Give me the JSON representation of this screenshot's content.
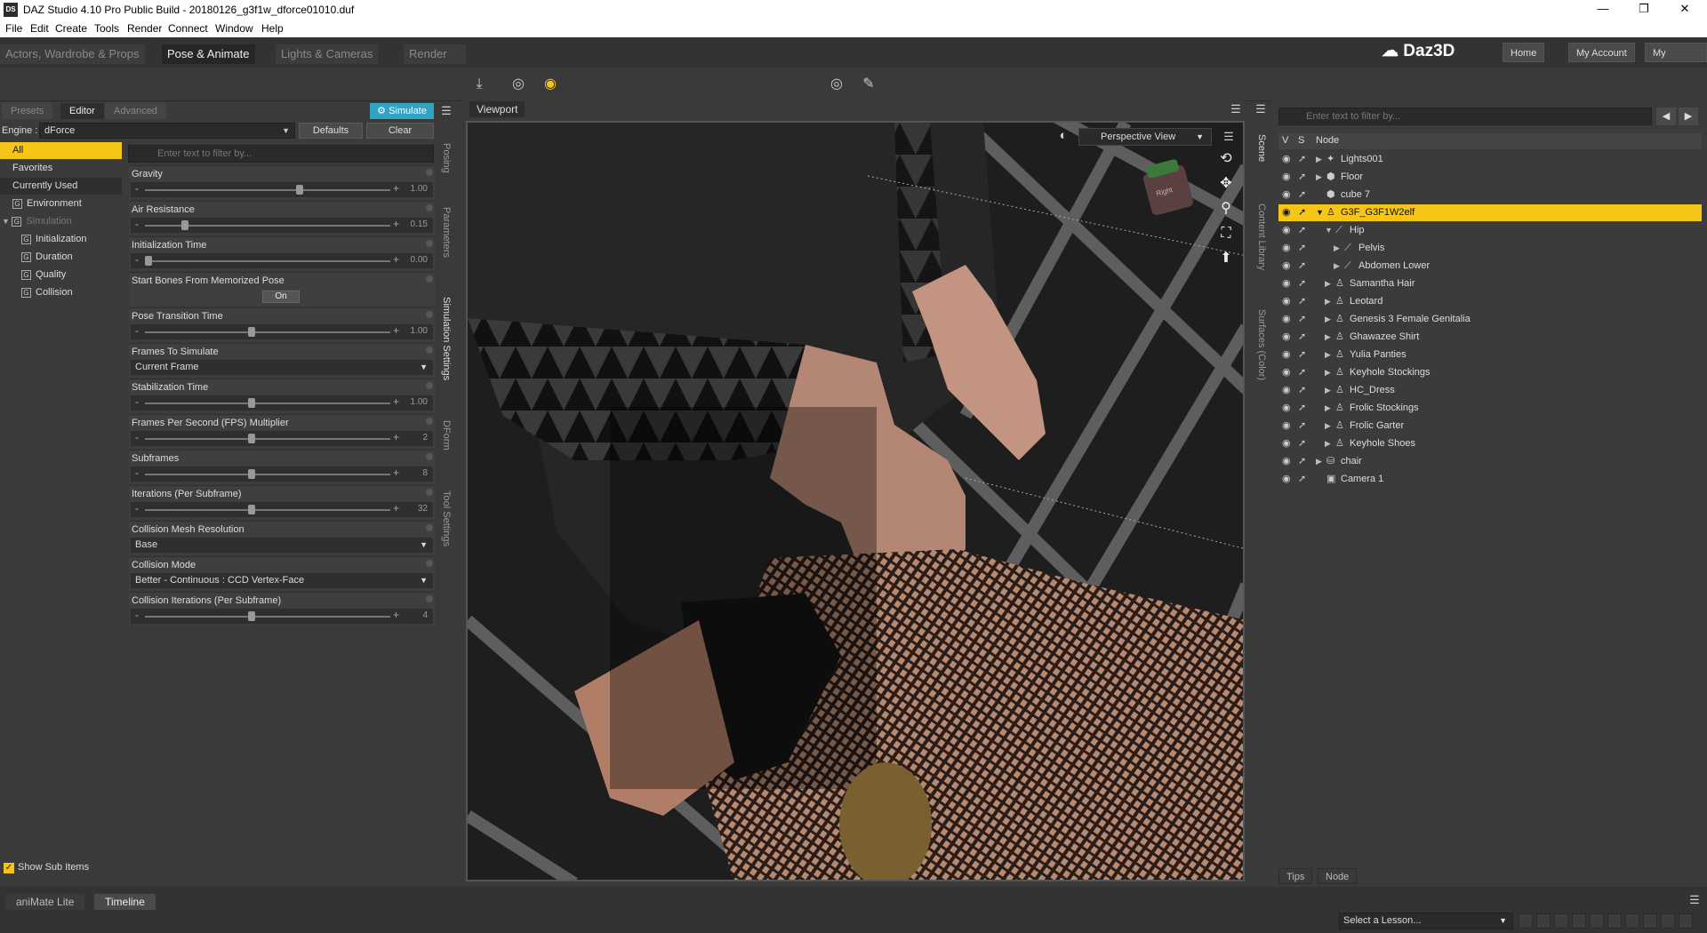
{
  "window": {
    "title": "DAZ Studio 4.10 Pro Public Build - 20180126_g3f1w_dforce01010.duf",
    "app_icon": "DS",
    "minimize": "—",
    "restore": "❐",
    "close": "✕"
  },
  "menu": [
    "File",
    "Edit",
    "Create",
    "Tools",
    "Render",
    "Connect",
    "Window",
    "Help"
  ],
  "rooms": [
    "Actors, Wardrobe & Props",
    "Pose & Animate",
    "Lights & Cameras",
    "Render"
  ],
  "brand": "Daz3D",
  "top_links": [
    "Home",
    "My Account",
    "My Gallery"
  ],
  "left": {
    "tabs": [
      "Presets",
      "Editor",
      "Advanced"
    ],
    "simulate": "Simulate",
    "engine_label": "Engine :",
    "engine_value": "dForce",
    "defaults": "Defaults",
    "clear": "Clear",
    "filter_placeholder": "Enter text to filter by...",
    "categories": [
      "All",
      "Favorites",
      "Currently Used",
      "Environment",
      "Simulation",
      "Initialization",
      "Duration",
      "Quality",
      "Collision"
    ],
    "show_sub_items": "Show Sub Items",
    "side_tabs": [
      "Posing",
      "Parameters",
      "Simulation Settings",
      "DForm",
      "Tool Settings"
    ]
  },
  "props": [
    {
      "label": "Gravity",
      "value": "1.00",
      "pos": 0.63
    },
    {
      "label": "Air Resistance",
      "value": "0.15",
      "pos": 0.15
    },
    {
      "label": "Initialization Time",
      "value": "0.00",
      "pos": 0.0
    },
    {
      "label": "Start Bones From Memorized Pose",
      "button": "On"
    },
    {
      "label": "Pose Transition Time",
      "value": "1.00",
      "pos": 0.43
    },
    {
      "label": "Frames To Simulate",
      "dropdown": "Current Frame"
    },
    {
      "label": "Stabilization Time",
      "value": "1.00",
      "pos": 0.43
    },
    {
      "label": "Frames Per Second (FPS) Multiplier",
      "value": "2",
      "pos": 0.43
    },
    {
      "label": "Subframes",
      "value": "8",
      "pos": 0.43
    },
    {
      "label": "Iterations (Per Subframe)",
      "value": "32",
      "pos": 0.43
    },
    {
      "label": "Collision Mesh Resolution",
      "dropdown": "Base"
    },
    {
      "label": "Collision Mode",
      "dropdown": "Better - Continuous : CCD Vertex-Face"
    },
    {
      "label": "Collision Iterations (Per Subframe)",
      "value": "4",
      "pos": 0.43
    }
  ],
  "viewport": {
    "tab": "Viewport",
    "camera": "Perspective View",
    "cube_label": "Right"
  },
  "scene": {
    "filter_placeholder": "Enter text to filter by...",
    "cols": [
      "V",
      "S",
      "Node"
    ],
    "nodes": [
      {
        "label": "Lights001",
        "depth": 0,
        "exp": "▶",
        "icon": "✦"
      },
      {
        "label": "Floor",
        "depth": 0,
        "exp": "▶",
        "icon": "⬢"
      },
      {
        "label": "cube 7",
        "depth": 0,
        "exp": "",
        "icon": "⬢"
      },
      {
        "label": "G3F_G3F1W2elf",
        "depth": 0,
        "exp": "▼",
        "icon": "♙",
        "selected": true
      },
      {
        "label": "Hip",
        "depth": 1,
        "exp": "▼",
        "icon": "⟋"
      },
      {
        "label": "Pelvis",
        "depth": 2,
        "exp": "▶",
        "icon": "⟋"
      },
      {
        "label": "Abdomen Lower",
        "depth": 2,
        "exp": "▶",
        "icon": "⟋"
      },
      {
        "label": "Samantha Hair",
        "depth": 1,
        "exp": "▶",
        "icon": "♙"
      },
      {
        "label": "Leotard",
        "depth": 1,
        "exp": "▶",
        "icon": "♙"
      },
      {
        "label": "Genesis 3 Female Genitalia",
        "depth": 1,
        "exp": "▶",
        "icon": "♙"
      },
      {
        "label": "Ghawazee Shirt",
        "depth": 1,
        "exp": "▶",
        "icon": "♙"
      },
      {
        "label": "Yulia Panties",
        "depth": 1,
        "exp": "▶",
        "icon": "♙"
      },
      {
        "label": "Keyhole Stockings",
        "depth": 1,
        "exp": "▶",
        "icon": "♙"
      },
      {
        "label": "HC_Dress",
        "depth": 1,
        "exp": "▶",
        "icon": "♙"
      },
      {
        "label": "Frolic Stockings",
        "depth": 1,
        "exp": "▶",
        "icon": "♙"
      },
      {
        "label": "Frolic Garter",
        "depth": 1,
        "exp": "▶",
        "icon": "♙"
      },
      {
        "label": "Keyhole Shoes",
        "depth": 1,
        "exp": "▶",
        "icon": "♙"
      },
      {
        "label": "chair",
        "depth": 0,
        "exp": "▶",
        "icon": "⛁"
      },
      {
        "label": "Camera 1",
        "depth": 0,
        "exp": "",
        "icon": "▣"
      }
    ],
    "side_tabs": [
      "Scene",
      "Content Library",
      "Surfaces (Color)"
    ],
    "bottom_tabs": [
      "Tips",
      "Node"
    ]
  },
  "bottom": {
    "tabs": [
      "aniMate Lite",
      "Timeline"
    ],
    "lesson": "Select a Lesson..."
  }
}
